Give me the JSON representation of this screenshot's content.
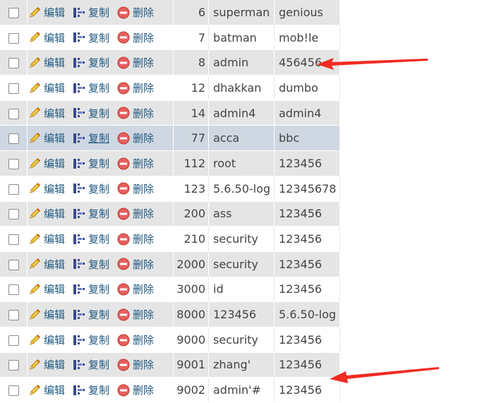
{
  "actions": {
    "edit": "编辑",
    "copy": "复制",
    "delete": "删除"
  },
  "icons": {
    "edit": "pencil-icon",
    "copy": "copy-icon",
    "delete": "delete-icon"
  },
  "colors": {
    "link": "#235a81",
    "row_alt": "#e5e5e5",
    "row_highlight": "#cfd7e2",
    "annotation_arrow": "#f02b22"
  },
  "rows": [
    {
      "id": "6",
      "username": "superman",
      "password": "genious"
    },
    {
      "id": "7",
      "username": "batman",
      "password": "mob!le"
    },
    {
      "id": "8",
      "username": "admin",
      "password": "456456"
    },
    {
      "id": "12",
      "username": "dhakkan",
      "password": "dumbo"
    },
    {
      "id": "14",
      "username": "admin4",
      "password": "admin4"
    },
    {
      "id": "77",
      "username": "acca",
      "password": "bbc"
    },
    {
      "id": "112",
      "username": "root",
      "password": "123456"
    },
    {
      "id": "123",
      "username": "5.6.50-log",
      "password": "12345678"
    },
    {
      "id": "200",
      "username": "ass",
      "password": "123456"
    },
    {
      "id": "210",
      "username": "security",
      "password": "123456"
    },
    {
      "id": "2000",
      "username": "security",
      "password": "123456"
    },
    {
      "id": "3000",
      "username": "id",
      "password": "123456"
    },
    {
      "id": "8000",
      "username": "123456",
      "password": "5.6.50-log"
    },
    {
      "id": "9000",
      "username": "security",
      "password": "123456"
    },
    {
      "id": "9001",
      "username": "zhang'",
      "password": "123456"
    },
    {
      "id": "9002",
      "username": "admin'#",
      "password": "123456"
    }
  ]
}
